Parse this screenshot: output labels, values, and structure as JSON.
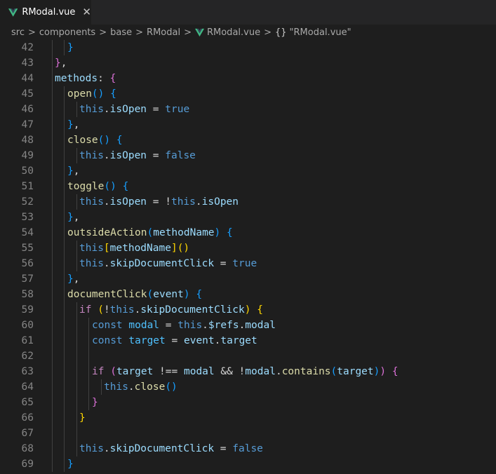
{
  "tab": {
    "label": "RModal.vue",
    "close_glyph": "✕",
    "icon": "vue-icon"
  },
  "breadcrumb": {
    "items": [
      "src",
      "components",
      "base",
      "RModal",
      "RModal.vue",
      "\"RModal.vue\""
    ],
    "separator": ">",
    "braces": "{}"
  },
  "colors": {
    "keyword": "#569cd6",
    "control": "#c586c0",
    "function": "#dcdcaa",
    "variable": "#9cdcfe",
    "bracket_gold": "#ffd700",
    "bracket_orchid": "#da70d6",
    "bracket_blue": "#179fff",
    "background": "#1e1e1e",
    "line_number": "#858585",
    "vue_green": "#41b883"
  },
  "lines": [
    {
      "n": "42",
      "indent": 2,
      "tokens": [
        [
          "b3",
          "}"
        ]
      ]
    },
    {
      "n": "43",
      "indent": 1,
      "tokens": [
        [
          "b2",
          "}"
        ],
        [
          "p",
          ","
        ]
      ]
    },
    {
      "n": "44",
      "indent": 1,
      "tokens": [
        [
          "prop",
          "methods"
        ],
        [
          "p",
          ": "
        ],
        [
          "b2",
          "{"
        ]
      ]
    },
    {
      "n": "45",
      "indent": 2,
      "tokens": [
        [
          "fn",
          "open"
        ],
        [
          "b3",
          "()"
        ],
        [
          "p",
          " "
        ],
        [
          "b3",
          "{"
        ]
      ]
    },
    {
      "n": "46",
      "indent": 3,
      "tokens": [
        [
          "kw",
          "this"
        ],
        [
          "p",
          "."
        ],
        [
          "var",
          "isOpen"
        ],
        [
          "p",
          " = "
        ],
        [
          "kw",
          "true"
        ]
      ]
    },
    {
      "n": "47",
      "indent": 2,
      "tokens": [
        [
          "b3",
          "}"
        ],
        [
          "p",
          ","
        ]
      ]
    },
    {
      "n": "48",
      "indent": 2,
      "tokens": [
        [
          "fn",
          "close"
        ],
        [
          "b3",
          "()"
        ],
        [
          "p",
          " "
        ],
        [
          "b3",
          "{"
        ]
      ]
    },
    {
      "n": "49",
      "indent": 3,
      "tokens": [
        [
          "kw",
          "this"
        ],
        [
          "p",
          "."
        ],
        [
          "var",
          "isOpen"
        ],
        [
          "p",
          " = "
        ],
        [
          "kw",
          "false"
        ]
      ]
    },
    {
      "n": "50",
      "indent": 2,
      "tokens": [
        [
          "b3",
          "}"
        ],
        [
          "p",
          ","
        ]
      ]
    },
    {
      "n": "51",
      "indent": 2,
      "tokens": [
        [
          "fn",
          "toggle"
        ],
        [
          "b3",
          "()"
        ],
        [
          "p",
          " "
        ],
        [
          "b3",
          "{"
        ]
      ]
    },
    {
      "n": "52",
      "indent": 3,
      "tokens": [
        [
          "kw",
          "this"
        ],
        [
          "p",
          "."
        ],
        [
          "var",
          "isOpen"
        ],
        [
          "p",
          " = !"
        ],
        [
          "kw",
          "this"
        ],
        [
          "p",
          "."
        ],
        [
          "var",
          "isOpen"
        ]
      ]
    },
    {
      "n": "53",
      "indent": 2,
      "tokens": [
        [
          "b3",
          "}"
        ],
        [
          "p",
          ","
        ]
      ]
    },
    {
      "n": "54",
      "indent": 2,
      "tokens": [
        [
          "fn",
          "outsideAction"
        ],
        [
          "b3",
          "("
        ],
        [
          "var",
          "methodName"
        ],
        [
          "b3",
          ")"
        ],
        [
          "p",
          " "
        ],
        [
          "b3",
          "{"
        ]
      ]
    },
    {
      "n": "55",
      "indent": 3,
      "tokens": [
        [
          "kw",
          "this"
        ],
        [
          "b1",
          "["
        ],
        [
          "var",
          "methodName"
        ],
        [
          "b1",
          "]"
        ],
        [
          "b1",
          "()"
        ]
      ]
    },
    {
      "n": "56",
      "indent": 3,
      "tokens": [
        [
          "kw",
          "this"
        ],
        [
          "p",
          "."
        ],
        [
          "var",
          "skipDocumentClick"
        ],
        [
          "p",
          " = "
        ],
        [
          "kw",
          "true"
        ]
      ]
    },
    {
      "n": "57",
      "indent": 2,
      "tokens": [
        [
          "b3",
          "}"
        ],
        [
          "p",
          ","
        ]
      ]
    },
    {
      "n": "58",
      "indent": 2,
      "tokens": [
        [
          "fn",
          "documentClick"
        ],
        [
          "b3",
          "("
        ],
        [
          "var",
          "event"
        ],
        [
          "b3",
          ")"
        ],
        [
          "p",
          " "
        ],
        [
          "b3",
          "{"
        ]
      ]
    },
    {
      "n": "59",
      "indent": 3,
      "tokens": [
        [
          "ctl",
          "if"
        ],
        [
          "p",
          " "
        ],
        [
          "b1",
          "("
        ],
        [
          "p",
          "!"
        ],
        [
          "kw",
          "this"
        ],
        [
          "p",
          "."
        ],
        [
          "var",
          "skipDocumentClick"
        ],
        [
          "b1",
          ")"
        ],
        [
          "p",
          " "
        ],
        [
          "b1",
          "{"
        ]
      ]
    },
    {
      "n": "60",
      "indent": 4,
      "tokens": [
        [
          "kw",
          "const"
        ],
        [
          "p",
          " "
        ],
        [
          "const",
          "modal"
        ],
        [
          "p",
          " = "
        ],
        [
          "kw",
          "this"
        ],
        [
          "p",
          "."
        ],
        [
          "var",
          "$refs"
        ],
        [
          "p",
          "."
        ],
        [
          "var",
          "modal"
        ]
      ]
    },
    {
      "n": "61",
      "indent": 4,
      "tokens": [
        [
          "kw",
          "const"
        ],
        [
          "p",
          " "
        ],
        [
          "const",
          "target"
        ],
        [
          "p",
          " = "
        ],
        [
          "var",
          "event"
        ],
        [
          "p",
          "."
        ],
        [
          "var",
          "target"
        ]
      ]
    },
    {
      "n": "62",
      "indent": 4,
      "tokens": []
    },
    {
      "n": "63",
      "indent": 4,
      "tokens": [
        [
          "ctl",
          "if"
        ],
        [
          "p",
          " "
        ],
        [
          "b2",
          "("
        ],
        [
          "var",
          "target"
        ],
        [
          "p",
          " !== "
        ],
        [
          "var",
          "modal"
        ],
        [
          "p",
          " && !"
        ],
        [
          "var",
          "modal"
        ],
        [
          "p",
          "."
        ],
        [
          "fn",
          "contains"
        ],
        [
          "b3",
          "("
        ],
        [
          "var",
          "target"
        ],
        [
          "b3",
          ")"
        ],
        [
          "b2",
          ")"
        ],
        [
          "p",
          " "
        ],
        [
          "b2",
          "{"
        ]
      ]
    },
    {
      "n": "64",
      "indent": 5,
      "tokens": [
        [
          "kw",
          "this"
        ],
        [
          "p",
          "."
        ],
        [
          "fn",
          "close"
        ],
        [
          "b3",
          "()"
        ]
      ]
    },
    {
      "n": "65",
      "indent": 4,
      "tokens": [
        [
          "b2",
          "}"
        ]
      ]
    },
    {
      "n": "66",
      "indent": 3,
      "tokens": [
        [
          "b1",
          "}"
        ]
      ]
    },
    {
      "n": "67",
      "indent": 3,
      "tokens": []
    },
    {
      "n": "68",
      "indent": 3,
      "tokens": [
        [
          "kw",
          "this"
        ],
        [
          "p",
          "."
        ],
        [
          "var",
          "skipDocumentClick"
        ],
        [
          "p",
          " = "
        ],
        [
          "kw",
          "false"
        ]
      ]
    },
    {
      "n": "69",
      "indent": 2,
      "tokens": [
        [
          "b3",
          "}"
        ]
      ]
    }
  ]
}
